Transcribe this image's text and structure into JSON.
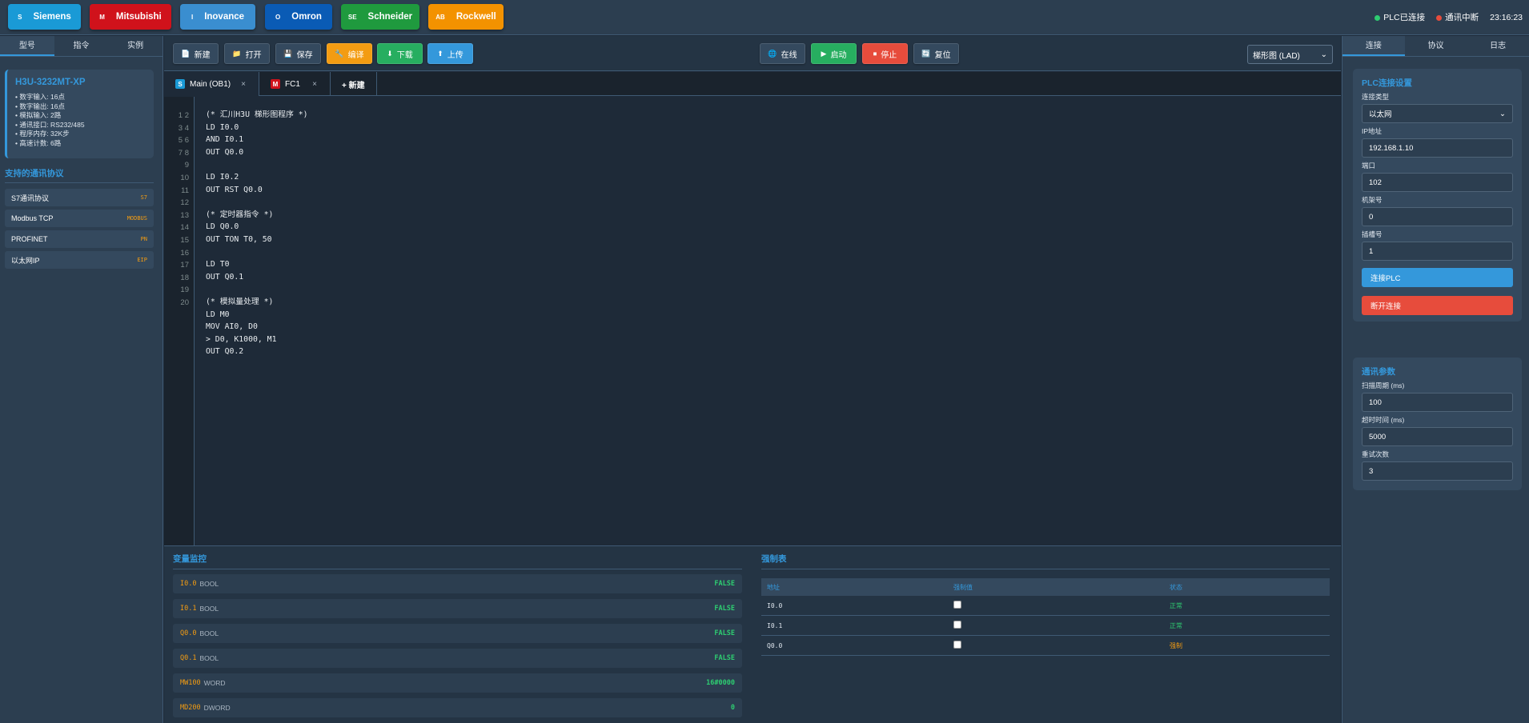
{
  "brands": [
    {
      "icon": "S",
      "label": "Siemens",
      "color": "#1a9ad6"
    },
    {
      "icon": "M",
      "label": "Mitsubishi",
      "color": "#d0121b"
    },
    {
      "icon": "I",
      "label": "Inovance",
      "color": "#3a8ed0"
    },
    {
      "icon": "O",
      "label": "Omron",
      "color": "#0a5bb5"
    },
    {
      "icon": "SE",
      "label": "Schneider",
      "color": "#1f9a3e"
    },
    {
      "icon": "AB",
      "label": "Rockwell",
      "color": "#f39200"
    }
  ],
  "status": {
    "plc": {
      "text": "PLC已连接",
      "color": "#2ecc71"
    },
    "comm": {
      "text": "通讯中断",
      "color": "#e74c3c"
    },
    "time": "23:16:23"
  },
  "left": {
    "tabs": [
      "型号",
      "指令",
      "实例"
    ],
    "model": {
      "name": "H3U-3232MT-XP",
      "specs": [
        "• 数字输入: 16点",
        "• 数字输出: 16点",
        "• 模拟输入: 2路",
        "• 通讯接口: RS232/485",
        "• 程序内存: 32K步",
        "• 高速计数: 6路"
      ]
    },
    "protocol_title": "支持的通讯协议",
    "protocols": [
      {
        "name": "S7通讯协议",
        "badge": "S7"
      },
      {
        "name": "Modbus TCP",
        "badge": "MODBUS"
      },
      {
        "name": "PROFINET",
        "badge": "PN"
      },
      {
        "name": "以太网IP",
        "badge": "EIP"
      }
    ]
  },
  "toolbar": {
    "buttons": [
      {
        "icon": "📄",
        "label": "新建",
        "color": "#34495e"
      },
      {
        "icon": "📁",
        "label": "打开",
        "color": "#34495e"
      },
      {
        "icon": "💾",
        "label": "保存",
        "color": "#34495e"
      },
      {
        "icon": "🔧",
        "label": "编译",
        "color": "#f39c12"
      },
      {
        "icon": "⬇",
        "label": "下载",
        "color": "#27ae60"
      },
      {
        "icon": "⬆",
        "label": "上传",
        "color": "#3498db"
      },
      {
        "icon": "🌐",
        "label": "在线",
        "color": "#34495e"
      },
      {
        "icon": "▶",
        "label": "启动",
        "color": "#27ae60"
      },
      {
        "icon": "⏹",
        "label": "停止",
        "color": "#e74c3c"
      },
      {
        "icon": "🔄",
        "label": "复位",
        "color": "#34495e"
      }
    ],
    "view": "梯形图 (LAD)"
  },
  "file_tabs": [
    {
      "icon": "S",
      "label": "Main (OB1)",
      "close": "×",
      "color": "#1a9ad6"
    },
    {
      "icon": "M",
      "label": "FC1",
      "close": "×",
      "color": "#d0121b"
    }
  ],
  "new_tab": "+ 新建",
  "editor": {
    "gutter": [
      "1 2",
      "3 4",
      "5 6",
      "7 8",
      "9",
      "10",
      "11",
      "12",
      "13",
      "14",
      "15",
      "16",
      "17",
      "18",
      "19",
      "20"
    ],
    "code": [
      "(* 汇川H3U 梯形图程序 *)",
      "LD I0.0",
      "AND I0.1",
      "OUT Q0.0",
      "",
      "LD I0.2",
      "OUT RST Q0.0",
      "",
      "(* 定时器指令 *)",
      "LD Q0.0",
      "OUT TON T0, 50",
      "",
      "LD T0",
      "OUT Q0.1",
      "",
      "(* 模拟量处理 *)",
      "LD M0",
      "MOV AI0, D0",
      "> D0, K1000, M1",
      "OUT Q0.2"
    ]
  },
  "monitor": {
    "title": "变量监控",
    "vars": [
      {
        "addr": "I0.0",
        "type": "BOOL",
        "value": "FALSE"
      },
      {
        "addr": "I0.1",
        "type": "BOOL",
        "value": "FALSE"
      },
      {
        "addr": "Q0.0",
        "type": "BOOL",
        "value": "FALSE"
      },
      {
        "addr": "Q0.1",
        "type": "BOOL",
        "value": "FALSE"
      },
      {
        "addr": "MW100",
        "type": "WORD",
        "value": "16#0000"
      },
      {
        "addr": "MD200",
        "type": "DWORD",
        "value": "0"
      }
    ]
  },
  "force": {
    "title": "强制表",
    "headers": [
      "地址",
      "强制值",
      "状态"
    ],
    "rows": [
      {
        "addr": "I0.0",
        "status": "正常",
        "color": "#2ecc71"
      },
      {
        "addr": "I0.1",
        "status": "正常",
        "color": "#2ecc71"
      },
      {
        "addr": "Q0.0",
        "status": "强制",
        "color": "#f39c12"
      }
    ]
  },
  "right": {
    "tabs": [
      "连接",
      "协议",
      "日志"
    ],
    "conn": {
      "title": "PLC连接设置",
      "fields": [
        {
          "label": "连接类型",
          "value": "以太网"
        },
        {
          "label": "IP地址",
          "value": "192.168.1.10"
        },
        {
          "label": "端口",
          "value": "102"
        },
        {
          "label": "机架号",
          "value": "0"
        },
        {
          "label": "插槽号",
          "value": "1"
        }
      ],
      "connect": "连接PLC",
      "disconnect": "断开连接"
    },
    "params": {
      "title": "通讯参数",
      "fields": [
        {
          "label": "扫描周期 (ms)",
          "value": "100"
        },
        {
          "label": "超时时间 (ms)",
          "value": "5000"
        },
        {
          "label": "重试次数",
          "value": "3"
        }
      ]
    }
  }
}
